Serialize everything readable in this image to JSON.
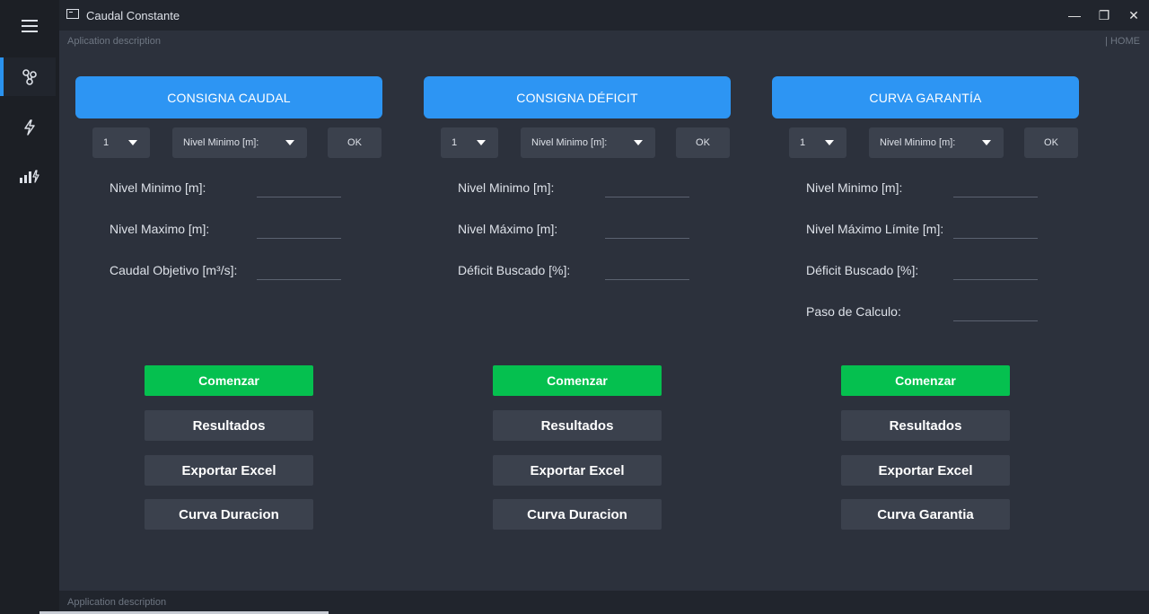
{
  "window": {
    "title": "Caudal Constante",
    "description_top": "Aplication description",
    "home_label": "| HOME",
    "description_bottom": "Application description",
    "controls": {
      "minimize": "—",
      "restore": "❐",
      "close": "✕"
    }
  },
  "sidebar": {
    "items": [
      {
        "icon": "hamburger-menu-icon"
      },
      {
        "icon": "nodes-icon",
        "active": true
      },
      {
        "icon": "lightning-icon"
      },
      {
        "icon": "bar-chart-lightning-icon"
      }
    ]
  },
  "colors": {
    "header_blue": "#2d95f3",
    "start_green": "#05c04f",
    "button_gray": "#3b414d",
    "background": "#2c313c",
    "sidebar": "#1c1f25"
  },
  "panels": [
    {
      "header": "CONSIGNA CAUDAL",
      "select_number": "1",
      "select_field": "Nivel Minimo [m]:",
      "ok": "OK",
      "fields": [
        {
          "label": "Nivel Minimo [m]:",
          "value": ""
        },
        {
          "label": "Nivel Maximo [m]:",
          "value": ""
        },
        {
          "label": "Caudal Objetivo [m³/s]:",
          "value": ""
        }
      ],
      "buttons": {
        "start": "Comenzar",
        "results": "Resultados",
        "export": "Exportar Excel",
        "curve": "Curva Duracion"
      }
    },
    {
      "header": "CONSIGNA DÉFICIT",
      "select_number": "1",
      "select_field": "Nivel Minimo [m]:",
      "ok": "OK",
      "fields": [
        {
          "label": "Nivel Minimo [m]:",
          "value": ""
        },
        {
          "label": "Nivel Máximo [m]:",
          "value": ""
        },
        {
          "label": "Déficit Buscado [%]:",
          "value": ""
        }
      ],
      "buttons": {
        "start": "Comenzar",
        "results": "Resultados",
        "export": "Exportar Excel",
        "curve": "Curva Duracion"
      }
    },
    {
      "header": "CURVA GARANTÍA",
      "select_number": "1",
      "select_field": "Nivel Minimo [m]:",
      "ok": "OK",
      "fields": [
        {
          "label": "Nivel Minimo [m]:",
          "value": ""
        },
        {
          "label": "Nivel Máximo Límite [m]:",
          "value": ""
        },
        {
          "label": "Déficit Buscado [%]:",
          "value": ""
        },
        {
          "label": "Paso de Calculo:",
          "value": ""
        }
      ],
      "buttons": {
        "start": "Comenzar",
        "results": "Resultados",
        "export": "Exportar Excel",
        "curve": "Curva Garantia"
      }
    }
  ]
}
